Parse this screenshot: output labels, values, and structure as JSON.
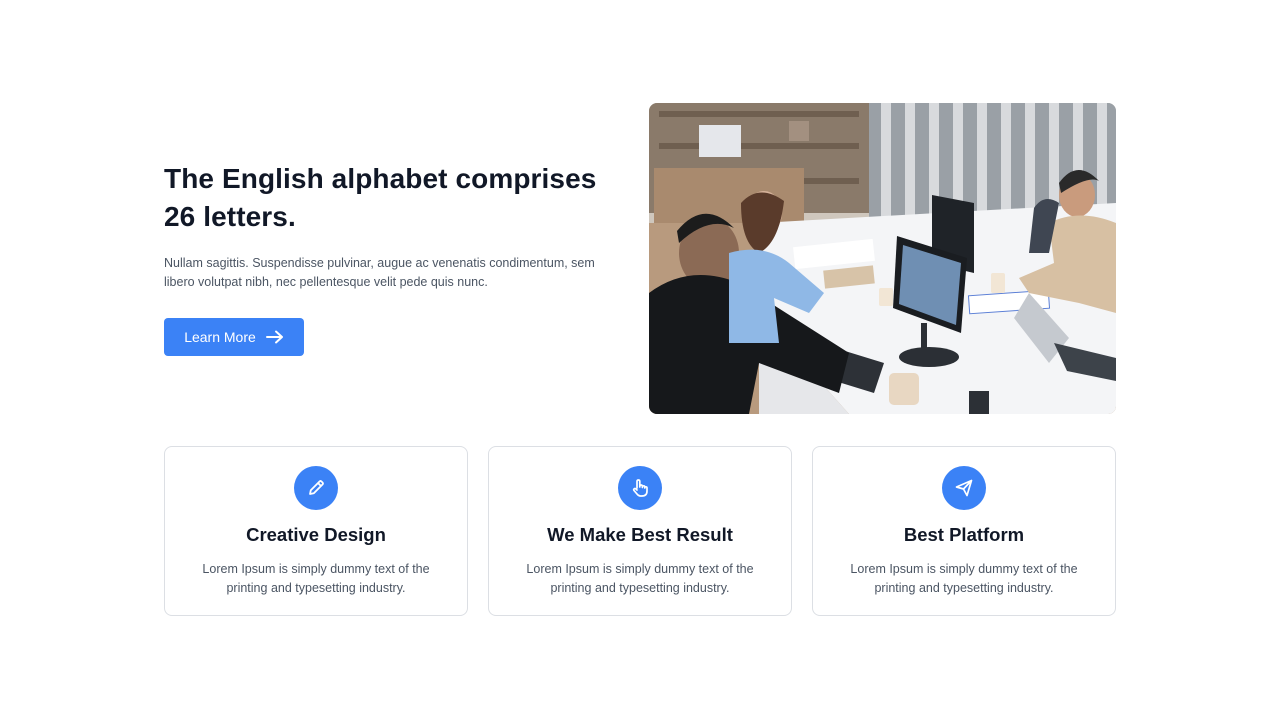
{
  "hero": {
    "title": "The English alphabet comprises 26 letters.",
    "description": "Nullam sagittis. Suspendisse pulvinar, augue ac venenatis condimentum, sem libero volutpat nibh, nec pellentesque velit pede quis nunc.",
    "button_label": "Learn More",
    "button_icon": "arrow-right-icon",
    "image_icon": "office-team-photo"
  },
  "features": [
    {
      "icon": "pencil-icon",
      "title": "Creative Design",
      "text": "Lorem Ipsum is simply dummy text of the printing and typesetting industry."
    },
    {
      "icon": "hand-pointer-icon",
      "title": "We Make Best Result",
      "text": "Lorem Ipsum is simply dummy text of the printing and typesetting industry."
    },
    {
      "icon": "paper-plane-icon",
      "title": "Best Platform",
      "text": "Lorem Ipsum is simply dummy text of the printing and typesetting industry."
    }
  ],
  "colors": {
    "accent": "#3b82f6",
    "heading": "#111827",
    "body_text": "#4b5563",
    "card_border": "#dcdfe4"
  }
}
